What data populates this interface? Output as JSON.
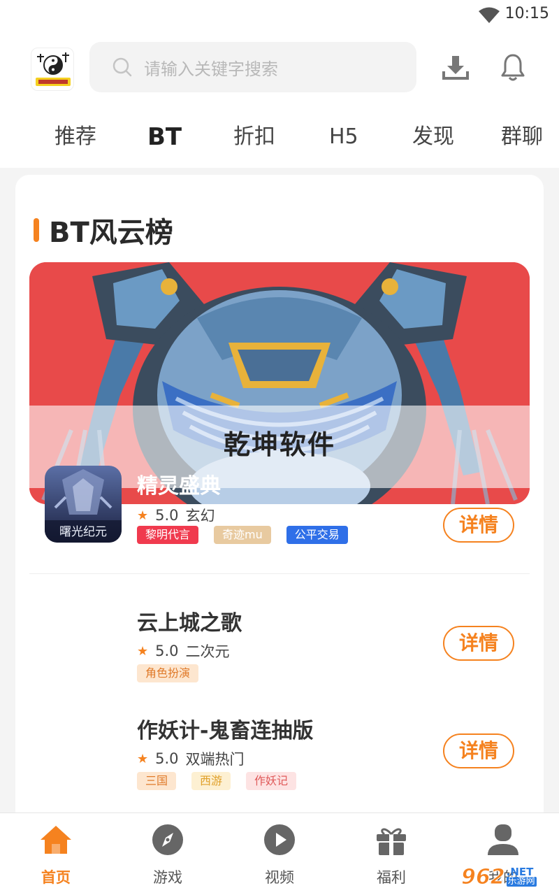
{
  "status_bar": {
    "time": "10:15"
  },
  "header": {
    "search_placeholder": "请输入关键字搜索",
    "tabs": [
      "推荐",
      "BT",
      "折扣",
      "H5",
      "发现",
      "群聊"
    ],
    "active_tab_index": 1
  },
  "section": {
    "title": "BT风云榜"
  },
  "watermark": {
    "text": "乾坤软件"
  },
  "games": [
    {
      "name": "精灵盛典",
      "rating": "5.0",
      "genre": "玄幻",
      "icon_caption": "曙光纪元",
      "tags": [
        {
          "label": "黎明代言",
          "bg": "#f03a4e",
          "fg": "#ffffff"
        },
        {
          "label": "奇迹mu",
          "bg": "#e8caa0",
          "fg": "#ffffff"
        },
        {
          "label": "公平交易",
          "bg": "#2f6fe8",
          "fg": "#ffffff"
        }
      ],
      "button": "详情"
    },
    {
      "name": "云上城之歌",
      "rating": "5.0",
      "genre": "二次元",
      "tags": [
        {
          "label": "角色扮演",
          "bg": "#fde6cf",
          "fg": "#e07a2a"
        }
      ],
      "button": "详情"
    },
    {
      "name": "作妖计-鬼畜连抽版",
      "rating": "5.0",
      "genre": "双端热门",
      "tags": [
        {
          "label": "三国",
          "bg": "#fde6cf",
          "fg": "#e07a2a"
        },
        {
          "label": "西游",
          "bg": "#fdf0d2",
          "fg": "#e0a02a"
        },
        {
          "label": "作妖记",
          "bg": "#fde3e3",
          "fg": "#e05a5a"
        }
      ],
      "button": "详情"
    }
  ],
  "bottom_nav": [
    {
      "label": "首页",
      "icon": "home-icon"
    },
    {
      "label": "游戏",
      "icon": "compass-icon"
    },
    {
      "label": "视频",
      "icon": "play-icon"
    },
    {
      "label": "福利",
      "icon": "gift-icon"
    },
    {
      "label": "我的",
      "icon": "user-icon"
    }
  ],
  "site_mark": {
    "num": "962",
    "net": ".NET",
    "cn": "乐游网"
  },
  "colors": {
    "accent": "#f5821f",
    "banner_bg": "#e84a4a"
  }
}
